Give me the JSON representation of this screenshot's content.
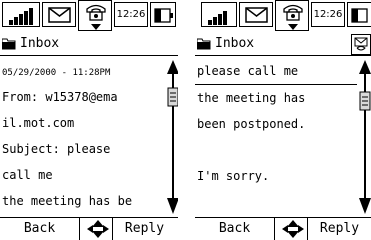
{
  "status": {
    "time": "12:26"
  },
  "left": {
    "title": "Inbox",
    "lines": [
      "05/29/2000 - 11:28PM",
      "From: w15378@ema",
      "il.mot.com",
      "Subject: please",
      "call me",
      "the meeting has be"
    ],
    "scroll_position": 0.15,
    "softkeys": {
      "left": "Back",
      "right": "Reply"
    }
  },
  "right": {
    "title": "Inbox",
    "lines": [
      "please call me",
      "the meeting has",
      "been postponed.",
      "",
      "I'm sorry.",
      ""
    ],
    "scroll_position": 0.2,
    "softkeys": {
      "left": "Back",
      "right": "Reply"
    }
  }
}
